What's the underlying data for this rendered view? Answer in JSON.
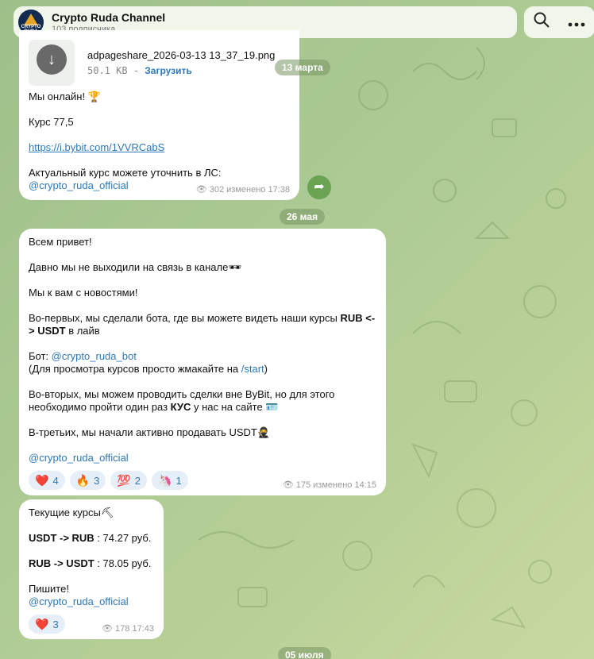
{
  "header": {
    "title": "Crypto Ruda Channel",
    "subtitle": "103 подписчика",
    "logo_text": "CRYPTO RUDA"
  },
  "dates": {
    "d1": "13 марта",
    "d2": "26 мая",
    "d3": "05 июля",
    "hidden_top": "13 марта"
  },
  "post1": {
    "file_name": "adpageshare_2026-03-13 13_37_19.png",
    "file_size": "50.1 KB",
    "file_sep": " - ",
    "download_label": "Загрузить",
    "l1": "Мы онлайн!",
    "l1_emoji": "🏆",
    "l2": "Курс 77,5",
    "link": "https://i.bybit.com/1VVRCabS",
    "l3": "Актуальный курс можете уточнить в ЛС:",
    "mention": "@crypto_ruda_official",
    "views": "302",
    "edited": "изменено 17:38"
  },
  "post2": {
    "l1": "Всем привет!",
    "l2": "Давно мы не выходили на связь в канале",
    "l2_emoji": "🕶",
    "l3": "Мы к вам с новостями!",
    "l4a": "Во-первых, мы сделали бота, где вы можете видеть наши курсы ",
    "l4b": "RUB <-> USDT",
    "l4c": " в лайв",
    "l5a": "Бот: ",
    "l5b": "@crypto_ruda_bot",
    "l6a": "(Для просмотра курсов просто жмакайте на ",
    "l6b": "/start",
    "l6c": ")",
    "l7a": "Во-вторых, мы можем проводить сделки вне ByBit, но для этого необходимо пройти один раз ",
    "l7b": "КУС",
    "l7c": " у нас на сайте",
    "l7_emoji": "🪪",
    "l8": "В-третьих, мы начали активно продавать USDT",
    "l8_emoji": "🥷",
    "mention": "@crypto_ruda_official",
    "reactions": [
      {
        "emoji": "❤️",
        "count": "4"
      },
      {
        "emoji": "🔥",
        "count": "3"
      },
      {
        "emoji": "💯",
        "count": "2"
      },
      {
        "emoji": "🦄",
        "count": "1"
      }
    ],
    "views": "175",
    "edited": "изменено 14:15"
  },
  "post3": {
    "l1": "Текущие курсы",
    "l1_emoji": "⛏",
    "l2a": "USDT -> RUB",
    "l2b": " : 74.27 руб.",
    "l3a": "RUB -> USDT",
    "l3b": " : 78.05 руб.",
    "l4": "Пишите!",
    "mention": "@crypto_ruda_official",
    "reaction": {
      "emoji": "❤️",
      "count": "3"
    },
    "views": "178",
    "time": "17:43"
  },
  "icons": {
    "search": "search-icon",
    "more": "more-icon",
    "forward": "forward-icon",
    "views": "eye-icon",
    "download": "download-icon"
  },
  "colors": {
    "accent": "#2f79b8",
    "background": "#a9c892",
    "forward_button": "#6aa453"
  }
}
